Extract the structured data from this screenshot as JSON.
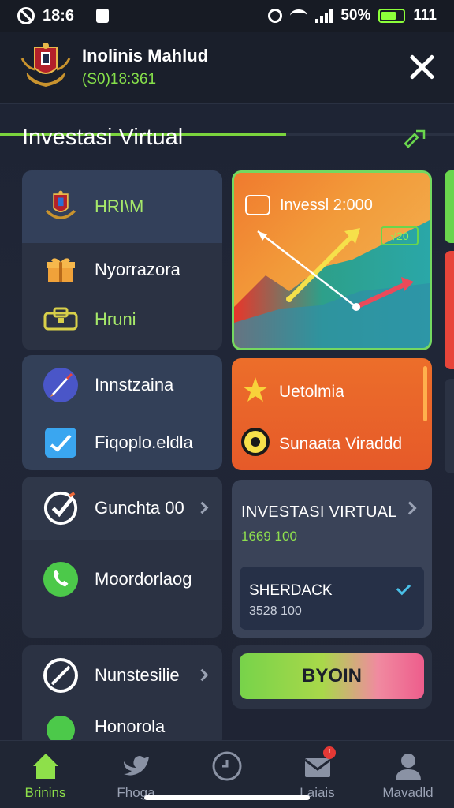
{
  "status_bar": {
    "time": "18:6",
    "battery_text": "50%",
    "signal_text": "111",
    "battery_level": 0.7
  },
  "header": {
    "name": "Inolinis Mahlud",
    "code": "(S0)18:361",
    "progress": 0.63
  },
  "section": {
    "title": "Investasi Virtual"
  },
  "left_column": {
    "card1": {
      "header_label": "HRI\\M",
      "items": [
        {
          "label": "Nyorrazora",
          "icon": "gift-icon"
        },
        {
          "label": "Hruni",
          "icon": "wallet-icon"
        }
      ]
    },
    "card2": {
      "items": [
        {
          "label": "Innstzaina",
          "icon": "rocket-icon"
        },
        {
          "label": "Fiqoplo.eldla",
          "icon": "chat-check-icon"
        }
      ]
    },
    "card3": {
      "header_label": "Gunchta 00",
      "item_label": "Moordorlaog"
    },
    "card4": {
      "header_label": "Nunstesilie",
      "item_label": "Honorola"
    }
  },
  "right_column": {
    "chart_card": {
      "label": "Invessl 2:000",
      "badge": "√20"
    },
    "promo_card": {
      "row1": "Uetolmia",
      "row2": "Sunaata Viraddd"
    },
    "invest_card": {
      "title": "INVESTASI VIRTUAL",
      "value": "1669 100",
      "inner_title": "SHERDACK",
      "inner_value": "3528 100"
    },
    "action_button": "BYOIN"
  },
  "bottom_nav": {
    "tabs": [
      {
        "label": "Brinins",
        "icon": "home-icon"
      },
      {
        "label": "Fhoga",
        "icon": "bird-icon"
      },
      {
        "label": "",
        "icon": "clock-icon"
      },
      {
        "label": "Laiais",
        "icon": "mail-icon"
      },
      {
        "label": "Mavadld",
        "icon": "user-icon"
      }
    ],
    "notification_badge": "!"
  },
  "colors": {
    "accent_green": "#7bd43d",
    "orange": "#ec6e2a",
    "card_bg": "#2b3243"
  }
}
